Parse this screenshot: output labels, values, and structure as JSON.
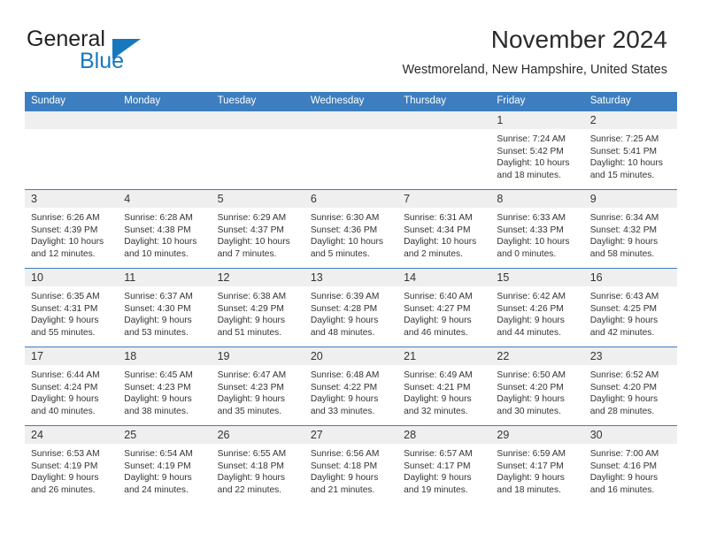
{
  "brand": {
    "name_top": "General",
    "name_bottom": "Blue",
    "triangle_icon": "triangle-icon",
    "color_primary": "#1878be",
    "color_text": "#231f20"
  },
  "header": {
    "title": "November 2024",
    "subtitle": "Westmoreland, New Hampshire, United States",
    "header_bg": "#3c7ebf",
    "daynum_bg": "#efefef"
  },
  "weekday_headers": [
    "Sunday",
    "Monday",
    "Tuesday",
    "Wednesday",
    "Thursday",
    "Friday",
    "Saturday"
  ],
  "weeks": [
    [
      {
        "day": "",
        "empty": true,
        "sunrise": "",
        "sunset": "",
        "daylight_line1": "",
        "daylight_line2": ""
      },
      {
        "day": "",
        "empty": true,
        "sunrise": "",
        "sunset": "",
        "daylight_line1": "",
        "daylight_line2": ""
      },
      {
        "day": "",
        "empty": true,
        "sunrise": "",
        "sunset": "",
        "daylight_line1": "",
        "daylight_line2": ""
      },
      {
        "day": "",
        "empty": true,
        "sunrise": "",
        "sunset": "",
        "daylight_line1": "",
        "daylight_line2": ""
      },
      {
        "day": "",
        "empty": true,
        "sunrise": "",
        "sunset": "",
        "daylight_line1": "",
        "daylight_line2": ""
      },
      {
        "day": "1",
        "empty": false,
        "sunrise": "Sunrise: 7:24 AM",
        "sunset": "Sunset: 5:42 PM",
        "daylight_line1": "Daylight: 10 hours",
        "daylight_line2": "and 18 minutes."
      },
      {
        "day": "2",
        "empty": false,
        "sunrise": "Sunrise: 7:25 AM",
        "sunset": "Sunset: 5:41 PM",
        "daylight_line1": "Daylight: 10 hours",
        "daylight_line2": "and 15 minutes."
      }
    ],
    [
      {
        "day": "3",
        "empty": false,
        "sunrise": "Sunrise: 6:26 AM",
        "sunset": "Sunset: 4:39 PM",
        "daylight_line1": "Daylight: 10 hours",
        "daylight_line2": "and 12 minutes."
      },
      {
        "day": "4",
        "empty": false,
        "sunrise": "Sunrise: 6:28 AM",
        "sunset": "Sunset: 4:38 PM",
        "daylight_line1": "Daylight: 10 hours",
        "daylight_line2": "and 10 minutes."
      },
      {
        "day": "5",
        "empty": false,
        "sunrise": "Sunrise: 6:29 AM",
        "sunset": "Sunset: 4:37 PM",
        "daylight_line1": "Daylight: 10 hours",
        "daylight_line2": "and 7 minutes."
      },
      {
        "day": "6",
        "empty": false,
        "sunrise": "Sunrise: 6:30 AM",
        "sunset": "Sunset: 4:36 PM",
        "daylight_line1": "Daylight: 10 hours",
        "daylight_line2": "and 5 minutes."
      },
      {
        "day": "7",
        "empty": false,
        "sunrise": "Sunrise: 6:31 AM",
        "sunset": "Sunset: 4:34 PM",
        "daylight_line1": "Daylight: 10 hours",
        "daylight_line2": "and 2 minutes."
      },
      {
        "day": "8",
        "empty": false,
        "sunrise": "Sunrise: 6:33 AM",
        "sunset": "Sunset: 4:33 PM",
        "daylight_line1": "Daylight: 10 hours",
        "daylight_line2": "and 0 minutes."
      },
      {
        "day": "9",
        "empty": false,
        "sunrise": "Sunrise: 6:34 AM",
        "sunset": "Sunset: 4:32 PM",
        "daylight_line1": "Daylight: 9 hours",
        "daylight_line2": "and 58 minutes."
      }
    ],
    [
      {
        "day": "10",
        "empty": false,
        "sunrise": "Sunrise: 6:35 AM",
        "sunset": "Sunset: 4:31 PM",
        "daylight_line1": "Daylight: 9 hours",
        "daylight_line2": "and 55 minutes."
      },
      {
        "day": "11",
        "empty": false,
        "sunrise": "Sunrise: 6:37 AM",
        "sunset": "Sunset: 4:30 PM",
        "daylight_line1": "Daylight: 9 hours",
        "daylight_line2": "and 53 minutes."
      },
      {
        "day": "12",
        "empty": false,
        "sunrise": "Sunrise: 6:38 AM",
        "sunset": "Sunset: 4:29 PM",
        "daylight_line1": "Daylight: 9 hours",
        "daylight_line2": "and 51 minutes."
      },
      {
        "day": "13",
        "empty": false,
        "sunrise": "Sunrise: 6:39 AM",
        "sunset": "Sunset: 4:28 PM",
        "daylight_line1": "Daylight: 9 hours",
        "daylight_line2": "and 48 minutes."
      },
      {
        "day": "14",
        "empty": false,
        "sunrise": "Sunrise: 6:40 AM",
        "sunset": "Sunset: 4:27 PM",
        "daylight_line1": "Daylight: 9 hours",
        "daylight_line2": "and 46 minutes."
      },
      {
        "day": "15",
        "empty": false,
        "sunrise": "Sunrise: 6:42 AM",
        "sunset": "Sunset: 4:26 PM",
        "daylight_line1": "Daylight: 9 hours",
        "daylight_line2": "and 44 minutes."
      },
      {
        "day": "16",
        "empty": false,
        "sunrise": "Sunrise: 6:43 AM",
        "sunset": "Sunset: 4:25 PM",
        "daylight_line1": "Daylight: 9 hours",
        "daylight_line2": "and 42 minutes."
      }
    ],
    [
      {
        "day": "17",
        "empty": false,
        "sunrise": "Sunrise: 6:44 AM",
        "sunset": "Sunset: 4:24 PM",
        "daylight_line1": "Daylight: 9 hours",
        "daylight_line2": "and 40 minutes."
      },
      {
        "day": "18",
        "empty": false,
        "sunrise": "Sunrise: 6:45 AM",
        "sunset": "Sunset: 4:23 PM",
        "daylight_line1": "Daylight: 9 hours",
        "daylight_line2": "and 38 minutes."
      },
      {
        "day": "19",
        "empty": false,
        "sunrise": "Sunrise: 6:47 AM",
        "sunset": "Sunset: 4:23 PM",
        "daylight_line1": "Daylight: 9 hours",
        "daylight_line2": "and 35 minutes."
      },
      {
        "day": "20",
        "empty": false,
        "sunrise": "Sunrise: 6:48 AM",
        "sunset": "Sunset: 4:22 PM",
        "daylight_line1": "Daylight: 9 hours",
        "daylight_line2": "and 33 minutes."
      },
      {
        "day": "21",
        "empty": false,
        "sunrise": "Sunrise: 6:49 AM",
        "sunset": "Sunset: 4:21 PM",
        "daylight_line1": "Daylight: 9 hours",
        "daylight_line2": "and 32 minutes."
      },
      {
        "day": "22",
        "empty": false,
        "sunrise": "Sunrise: 6:50 AM",
        "sunset": "Sunset: 4:20 PM",
        "daylight_line1": "Daylight: 9 hours",
        "daylight_line2": "and 30 minutes."
      },
      {
        "day": "23",
        "empty": false,
        "sunrise": "Sunrise: 6:52 AM",
        "sunset": "Sunset: 4:20 PM",
        "daylight_line1": "Daylight: 9 hours",
        "daylight_line2": "and 28 minutes."
      }
    ],
    [
      {
        "day": "24",
        "empty": false,
        "sunrise": "Sunrise: 6:53 AM",
        "sunset": "Sunset: 4:19 PM",
        "daylight_line1": "Daylight: 9 hours",
        "daylight_line2": "and 26 minutes."
      },
      {
        "day": "25",
        "empty": false,
        "sunrise": "Sunrise: 6:54 AM",
        "sunset": "Sunset: 4:19 PM",
        "daylight_line1": "Daylight: 9 hours",
        "daylight_line2": "and 24 minutes."
      },
      {
        "day": "26",
        "empty": false,
        "sunrise": "Sunrise: 6:55 AM",
        "sunset": "Sunset: 4:18 PM",
        "daylight_line1": "Daylight: 9 hours",
        "daylight_line2": "and 22 minutes."
      },
      {
        "day": "27",
        "empty": false,
        "sunrise": "Sunrise: 6:56 AM",
        "sunset": "Sunset: 4:18 PM",
        "daylight_line1": "Daylight: 9 hours",
        "daylight_line2": "and 21 minutes."
      },
      {
        "day": "28",
        "empty": false,
        "sunrise": "Sunrise: 6:57 AM",
        "sunset": "Sunset: 4:17 PM",
        "daylight_line1": "Daylight: 9 hours",
        "daylight_line2": "and 19 minutes."
      },
      {
        "day": "29",
        "empty": false,
        "sunrise": "Sunrise: 6:59 AM",
        "sunset": "Sunset: 4:17 PM",
        "daylight_line1": "Daylight: 9 hours",
        "daylight_line2": "and 18 minutes."
      },
      {
        "day": "30",
        "empty": false,
        "sunrise": "Sunrise: 7:00 AM",
        "sunset": "Sunset: 4:16 PM",
        "daylight_line1": "Daylight: 9 hours",
        "daylight_line2": "and 16 minutes."
      }
    ]
  ]
}
